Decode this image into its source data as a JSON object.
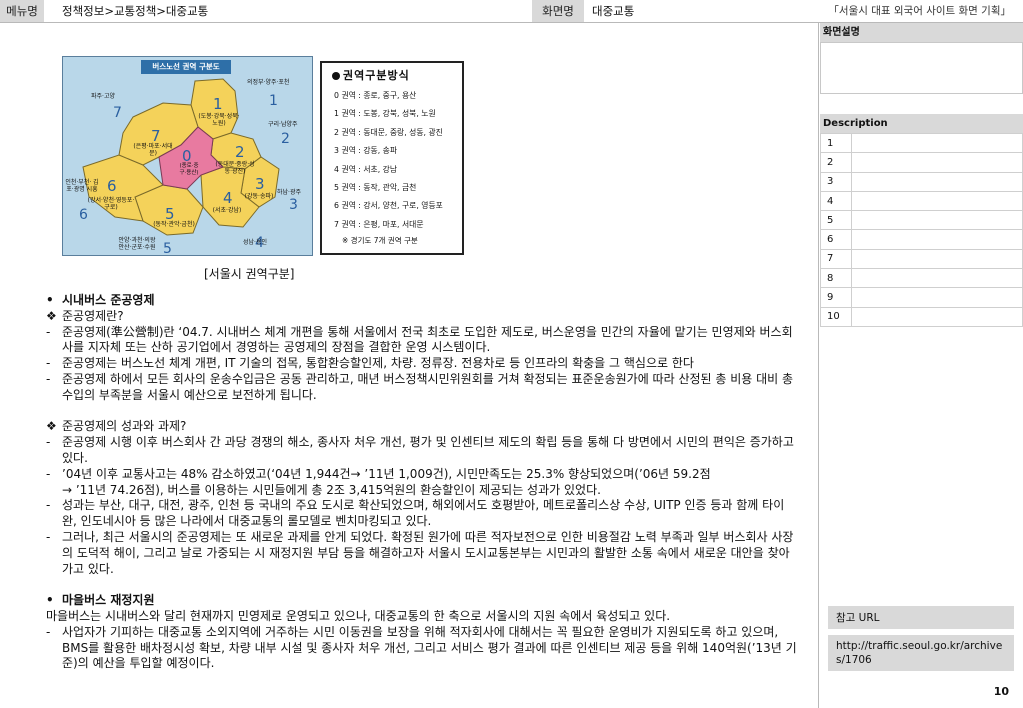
{
  "header": {
    "menu_label": "메뉴명",
    "menu_value": "정책정보>교통정책>대중교통",
    "screen_label": "화면명",
    "screen_value": "대중교통",
    "project_title": "「서울시 대표 외국어 사이트 화면 기획」"
  },
  "figure": {
    "map_title": "버스노선 권역 구분도",
    "zones": [
      {
        "num": "0",
        "label": "(종로·중구·용산)"
      },
      {
        "num": "1",
        "label": "(도봉·강북·성북·노원)"
      },
      {
        "num": "2",
        "label": "(동대문·중랑·성동·광진)"
      },
      {
        "num": "3",
        "label": "(강동·송파)"
      },
      {
        "num": "4",
        "label": "(서초·강남)"
      },
      {
        "num": "5",
        "label": "(동작·관악·금천)"
      },
      {
        "num": "6",
        "label": "(강서·양천·영등포·구로)"
      },
      {
        "num": "7",
        "label": "(은평·마포·서대문)"
      }
    ],
    "outer_regions": [
      {
        "num": "1",
        "label": "의정부·양주·포천"
      },
      {
        "num": "2",
        "label": "구리·남양주"
      },
      {
        "num": "3",
        "label": "하남·광주"
      },
      {
        "num": "4",
        "label": "성남·용인"
      },
      {
        "num": "5",
        "label": "안양·과천·의왕 안산·군포·수원"
      },
      {
        "num": "6",
        "label": "인천·부천· 김포·광명 시흥"
      },
      {
        "num": "7",
        "label": "파주·고양"
      }
    ],
    "legend_title": "권역구분방식",
    "legend_rows": [
      "0 권역 : 종로, 중구, 용산",
      "1 권역 : 도봉, 강북, 성북, 노원",
      "2 권역 : 동대문, 중랑, 성동, 광진",
      "3 권역 : 강동, 송파",
      "4 권역 : 서초, 강남",
      "5 권역 : 동작, 관악, 금천",
      "6 권역 : 강서, 양천, 구로, 영등포",
      "7 권역 : 은평, 마포, 서대문"
    ],
    "legend_note": "※ 경기도 7개 권역 구분",
    "caption": "[서울시 권역구분]"
  },
  "content": {
    "s1_heading": "시내버스 준공영제",
    "s1_q1": "준공영제란?",
    "s1_d1": "준공영제(準公營制)란 ‘04.7. 시내버스 체계 개편을 통해 서울에서 전국 최초로 도입한 제도로, 버스운영을 민간의 자율에 맡기는 민영제와 버스회사를 지자체 또는 산하 공기업에서 경영하는 공영제의 장점을 결합한 운영 시스템이다.",
    "s1_d2": "준공영제는 버스노선 체계 개편, IT 기술의 접목, 통합환승할인제, 차량. 정류장. 전용차로 등 인프라의 확충을 그 핵심으로 한다",
    "s1_d3": "준공영제 하에서 모든 회사의 운송수입금은 공동 관리하고, 매년 버스정책시민위원회를 거쳐 확정되는 표준운송원가에 따라 산정된 총 비용 대비 총 수입의 부족분을 서울시 예산으로 보전하게 됩니다.",
    "s1_q2": "준공영제의 성과와 과제?",
    "s1_e1": "준공영제 시행 이후 버스회사 간 과당 경쟁의 해소, 종사자 처우 개선, 평가 및 인센티브 제도의 확립 등을 통해 다 방면에서 시민의 편익은 증가하고 있다.",
    "s1_e2a": "’04년 이후 교통사고는 48% 감소하였고(‘04년 1,944건→ ’11년 1,009건), 시민만족도는 25.3% 향상되었으며(’06년 59.2점",
    "s1_e2b": "→ ’11년 74.26점), 버스를 이용하는 시민들에게 총 2조 3,415억원의 환승할인이 제공되는 성과가 있었다.",
    "s1_e3": "성과는 부산, 대구, 대전, 광주, 인천 등 국내의 주요 도시로 확산되었으며, 해외에서도 호평받아, 메트로폴리스상 수상, UITP 인증 등과 함께 타이완, 인도네시아 등 많은 나라에서 대중교통의 롤모델로 벤치마킹되고 있다.",
    "s1_e4": "그러나, 최근 서울시의 준공영제는 또 새로운 과제를 안게 되었다. 확정된 원가에 따른 적자보전으로 인한 비용절감 노력 부족과 일부 버스회사 사장의 도덕적 해이, 그리고 날로 가중되는 시 재정지원 부담 등을 해결하고자 서울시 도시교통본부는 시민과의 활발한 소통 속에서 새로운 대안을 찾아가고 있다.",
    "s2_heading": "마을버스 재정지원",
    "s2_intro": "마을버스는 시내버스와 달리 현재까지 민영제로 운영되고 있으나, 대중교통의 한 축으로 서울시의 지원 속에서 육성되고 있다.",
    "s2_d1": "사업자가 기피하는 대중교통 소외지역에 거주하는 시민 이동권을 보장을 위해 적자회사에 대해서는 꼭 필요한 운영비가 지원되도록 하고 있으며, BMS를 활용한 배차정시성 확보, 차량 내부 시설 및 종사자 처우 개선, 그리고 서비스 평가 결과에 따른 인센티브 제공 등을 위해 140억원(’13년 기준)의 예산을 투입할 예정이다."
  },
  "sidebar": {
    "screen_desc_label": "화면설명",
    "description_label": "Description",
    "rows": [
      "1",
      "2",
      "3",
      "4",
      "5",
      "6",
      "7",
      "8",
      "9",
      "10"
    ],
    "ref_label": "참고 URL",
    "ref_url": "http://traffic.seoul.go.kr/archives/1706",
    "page_number": "10"
  }
}
